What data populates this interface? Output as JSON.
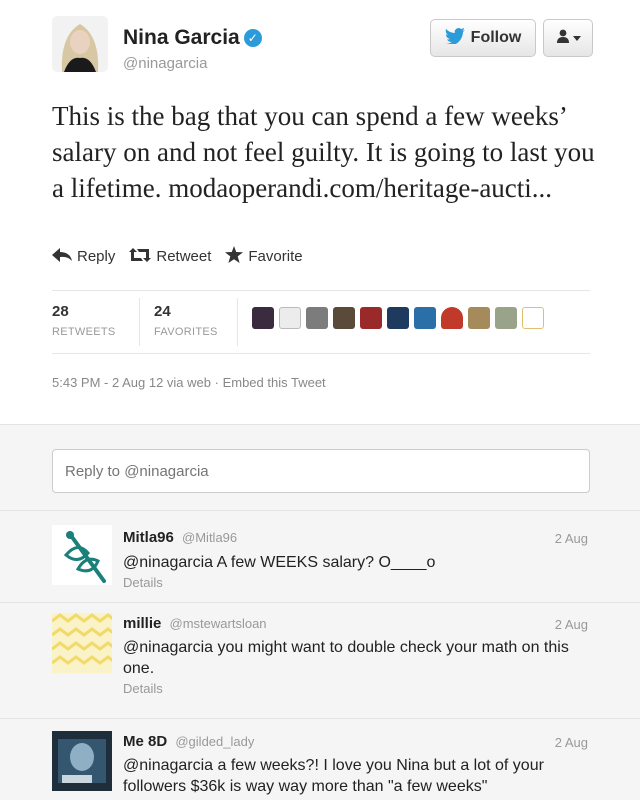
{
  "tweet": {
    "author_name": "Nina Garcia",
    "author_handle": "@ninagarcia",
    "follow_label": "Follow",
    "text": "This is the bag that you can spend a few weeks’ salary on and not feel guilty. It is going to last you a lifetime.",
    "link": "modaoperandi.com/heritage-aucti...",
    "actions": {
      "reply": "Reply",
      "retweet": "Retweet",
      "favorite": "Favorite"
    },
    "stats": {
      "retweets_count": "28",
      "retweets_label": "RETWEETS",
      "favorites_count": "24",
      "favorites_label": "FAVORITES"
    },
    "meta_time": "5:43 PM - 2 Aug 12 via web",
    "meta_embed": "Embed this Tweet"
  },
  "reply_box": {
    "placeholder": "Reply to @ninagarcia"
  },
  "replies": [
    {
      "name": "Mitla96",
      "handle": "@Mitla96",
      "date": "2 Aug",
      "text": "@ninagarcia A few WEEKS salary? O____o",
      "details": "Details"
    },
    {
      "name": "millie",
      "handle": "@mstewartsloan",
      "date": "2 Aug",
      "text": "@ninagarcia you might want to double check your math on this one.",
      "details": "Details"
    },
    {
      "name": "Me 8D",
      "handle": "@gilded_lady",
      "date": "2 Aug",
      "text": "@ninagarcia a few weeks?! I love you Nina but a lot of your followers $36k is way way more than \"a few weeks\"",
      "details": ""
    }
  ],
  "colors": {
    "twitter_blue": "#2b9bd9",
    "text_dark": "#222222",
    "text_muted": "#999999",
    "reply_bg": "#f5f5f5"
  },
  "icons": {
    "follow": "bird-icon",
    "user_menu": "user-icon",
    "reply": "reply-arrow-icon",
    "retweet": "retweet-icon",
    "favorite": "star-icon",
    "verified": "verified-check-icon"
  }
}
